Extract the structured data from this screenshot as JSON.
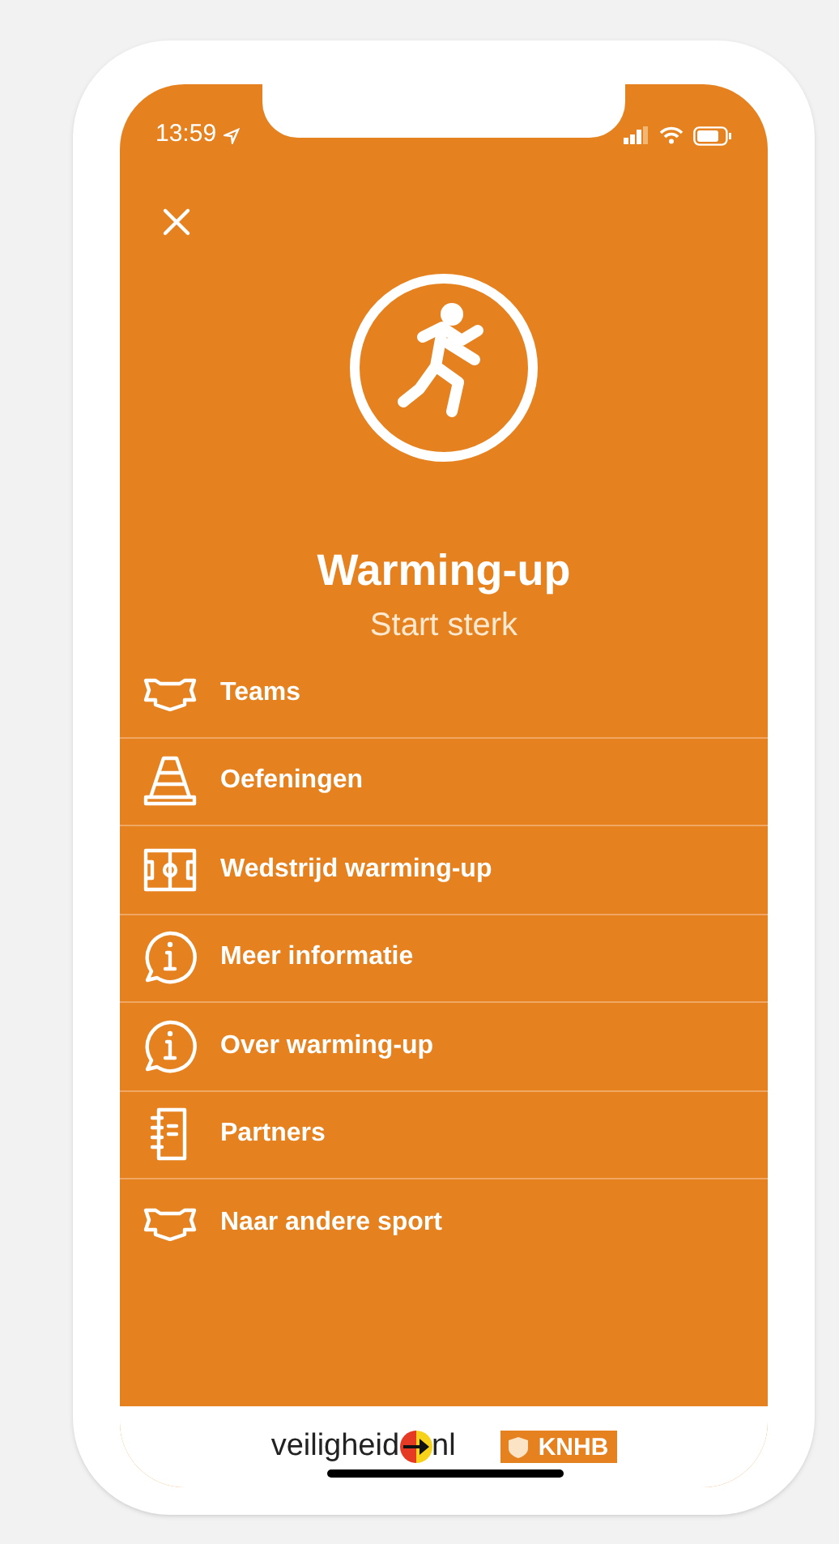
{
  "status_bar": {
    "time": "13:59"
  },
  "header": {
    "title": "Warming-up",
    "subtitle": "Start sterk"
  },
  "menu": [
    {
      "label": "Teams",
      "kind": "shirt"
    },
    {
      "label": "Oefeningen",
      "kind": "cone"
    },
    {
      "label": "Wedstrijd warming-up",
      "kind": "field"
    },
    {
      "label": "Meer informatie",
      "kind": "info"
    },
    {
      "label": "Over warming-up",
      "kind": "info"
    },
    {
      "label": "Partners",
      "kind": "notebook"
    },
    {
      "label": "Naar andere sport",
      "kind": "shirt"
    }
  ],
  "footer": {
    "logo_left": "veiligheid",
    "logo_left_suffix": "nl",
    "logo_right": "KNHB"
  }
}
